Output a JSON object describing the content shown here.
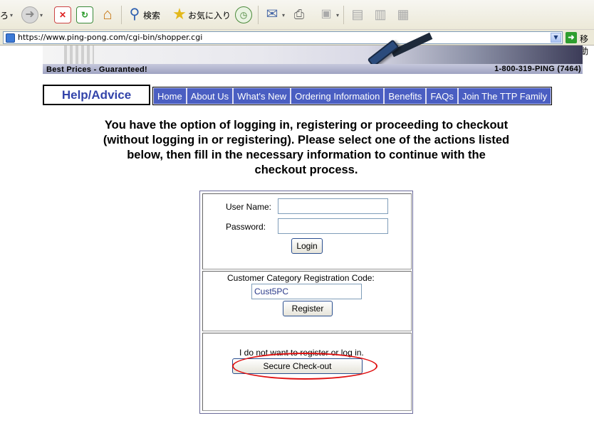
{
  "browser": {
    "toolbar": {
      "back_glyph": "ろ",
      "search_label": "検索",
      "favorites_label": "お気に入り"
    },
    "address_url": "https://www.ping-pong.com/cgi-bin/shopper.cgi",
    "go_label": "移動"
  },
  "header": {
    "tagline": "Best Prices - Guaranteed!",
    "phone": "1-800-319-PING (7464)"
  },
  "nav": {
    "help_label": "Help/Advice",
    "items": [
      {
        "label": "Home"
      },
      {
        "label": "About Us"
      },
      {
        "label": "What's New"
      },
      {
        "label": "Ordering Information"
      },
      {
        "label": "Benefits"
      },
      {
        "label": "FAQs"
      },
      {
        "label": "Join The TTP Family"
      }
    ]
  },
  "main": {
    "instructions": "You have the option of logging in, registering or proceeding to checkout (without logging in or registering). Please select one of the actions listed below, then fill in the necessary information to continue with the checkout process.",
    "login": {
      "username_label": "User Name:",
      "username_value": "",
      "password_label": "Password:",
      "password_value": "",
      "login_button": "Login"
    },
    "register": {
      "code_label": "Customer Category Registration Code:",
      "code_value": "Cust5PC",
      "register_button": "Register"
    },
    "guest": {
      "note": "I do not want to register or log in.",
      "checkout_button": "Secure Check-out"
    },
    "highlight_color": "#e01010"
  }
}
